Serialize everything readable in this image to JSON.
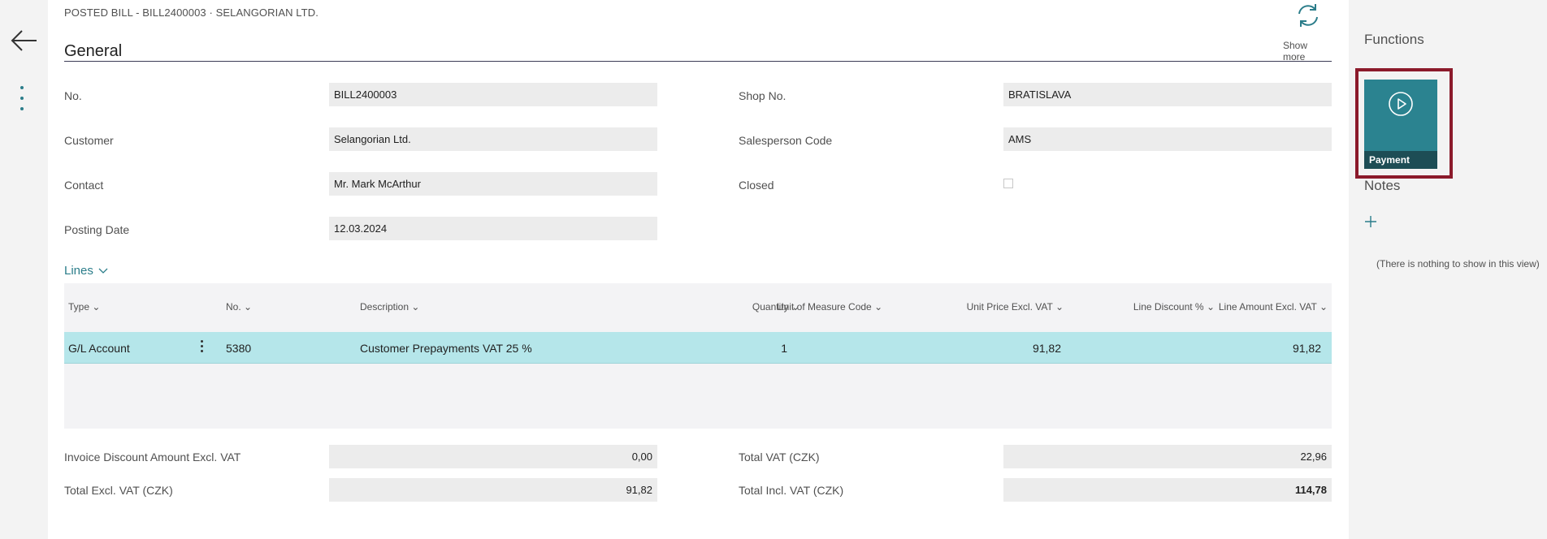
{
  "header": {
    "caption": "POSTED BILL - BILL2400003 · SELANGORIAN LTD.",
    "show_more": "Show more",
    "section_title": "General"
  },
  "fields": {
    "no": {
      "label": "No.",
      "value": "BILL2400003"
    },
    "customer": {
      "label": "Customer",
      "value": "Selangorian Ltd."
    },
    "contact": {
      "label": "Contact",
      "value": "Mr. Mark McArthur"
    },
    "posting_date": {
      "label": "Posting Date",
      "value": "12.03.2024"
    },
    "shop_no": {
      "label": "Shop No.",
      "value": "BRATISLAVA"
    },
    "salesperson": {
      "label": "Salesperson Code",
      "value": "AMS"
    },
    "closed": {
      "label": "Closed",
      "checked": false
    }
  },
  "lines": {
    "title": "Lines",
    "columns": [
      "Type",
      "No.",
      "Description",
      "Quantity",
      "Unit of Measure Code",
      "Unit Price Excl. VAT",
      "Line Discount %",
      "Line Amount Excl. VAT"
    ],
    "rows": [
      {
        "type": "G/L Account",
        "no": "5380",
        "description": "Customer Prepayments VAT 25 %",
        "quantity": "1",
        "uom": "",
        "unit_price": "91,82",
        "line_discount": "",
        "line_amount": "91,82"
      }
    ]
  },
  "totals": {
    "invoice_discount": {
      "label": "Invoice Discount Amount Excl. VAT",
      "value": "0,00"
    },
    "total_excl_vat": {
      "label": "Total Excl. VAT (CZK)",
      "value": "91,82"
    },
    "total_vat": {
      "label": "Total VAT (CZK)",
      "value": "22,96"
    },
    "total_incl_vat": {
      "label": "Total Incl. VAT (CZK)",
      "value": "114,78"
    }
  },
  "sidebar": {
    "functions_title": "Functions",
    "payment_label": "Payment",
    "notes_title": "Notes",
    "empty_note": "(There is nothing to show in this view)"
  },
  "colors": {
    "accent": "#2b7d8a",
    "selected_row": "#b5e6ea",
    "highlight_border": "#8b1a2b",
    "tile": "#2b8390"
  }
}
